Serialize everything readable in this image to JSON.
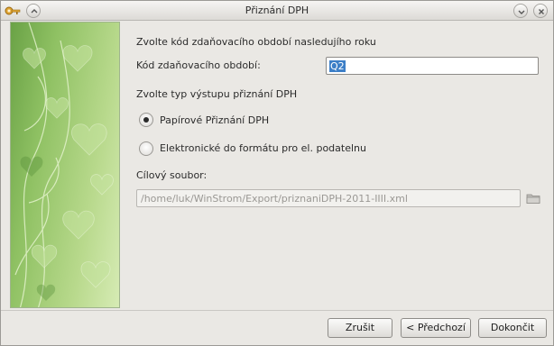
{
  "window": {
    "title": "Přiznání DPH"
  },
  "section_period": {
    "heading": "Zvolte kód zdaňovacího období nasledujího roku",
    "field_label": "Kód zdaňovacího období:",
    "field_value": "Q2"
  },
  "section_output": {
    "heading": "Zvolte typ výstupu přiznání DPH",
    "options": [
      {
        "label": "Papírové Přiznání DPH",
        "selected": true
      },
      {
        "label": "Elektronické do formátu pro el. podatelnu",
        "selected": false
      }
    ]
  },
  "target_file": {
    "label": "Cílový soubor:",
    "value": "/home/luk/WinStrom/Export/priznaniDPH-2011-IIII.xml"
  },
  "buttons": {
    "cancel": "Zrušit",
    "back": "< Předchozí",
    "finish": "Dokončit"
  },
  "icons": {
    "app": "key-icon",
    "minimize": "chevron-down-icon",
    "close": "close-icon",
    "browse": "folder-icon"
  },
  "colors": {
    "accent_selection": "#3d7fc7",
    "side_panel_green": "#8fc163"
  }
}
